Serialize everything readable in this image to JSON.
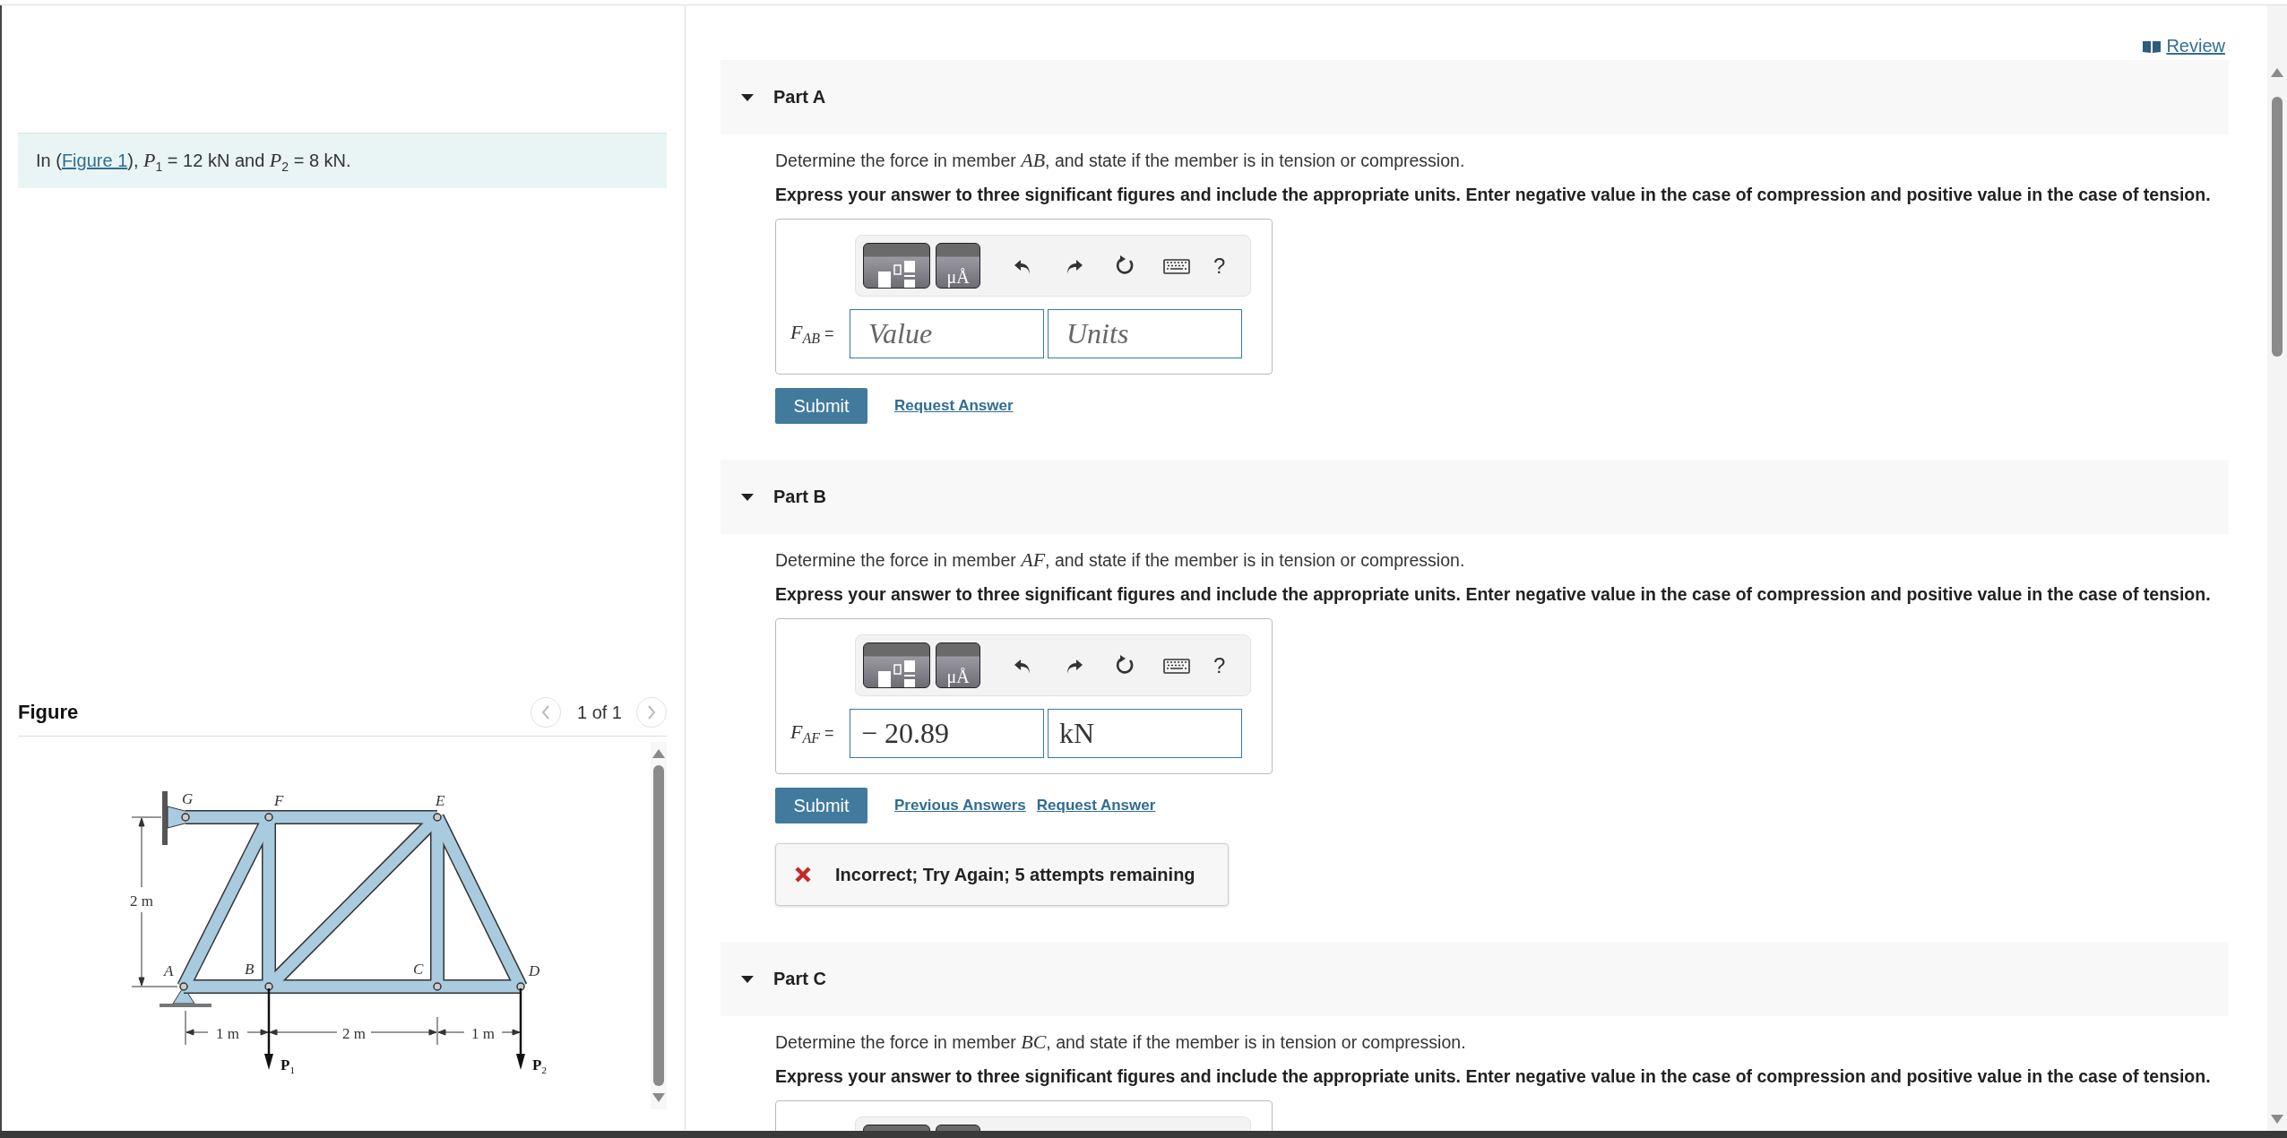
{
  "review_link": "Review",
  "problem": {
    "prefix": "In (",
    "link": "Figure 1",
    "suffix": "), *P*$_{1}$ = 12 kN and *P*$_{2}$ = 8 kN."
  },
  "figure": {
    "heading": "Figure",
    "pager": "1 of 1",
    "node_labels": [
      "G",
      "F",
      "E",
      "A",
      "B",
      "C",
      "D"
    ],
    "dimension_labels": [
      "2 m",
      "1 m",
      "2 m",
      "1 m"
    ],
    "load_labels": [
      "**P**$_{1}$",
      "**P**$_{2}$"
    ]
  },
  "parts": [
    {
      "title": "Part A",
      "expanded": true,
      "question": "Determine the force in member *AB*, and state if the member is in tension or compression.",
      "instruction": "Express your answer to three significant figures and include the appropriate units. Enter negative value in the case of compression and positive value in the case of tension.",
      "toolbar": {
        "units_button": "μÅ",
        "help": "?"
      },
      "answer": {
        "label": "*F*$_{AB}$ =",
        "value": {
          "placeholder": "Value"
        },
        "units": {
          "placeholder": "Units"
        }
      },
      "submit": "Submit",
      "links": [
        "Request Answer"
      ]
    },
    {
      "title": "Part B",
      "expanded": true,
      "question": "Determine the force in member *AF*, and state if the member is in tension or compression.",
      "instruction": "Express your answer to three significant figures and include the appropriate units. Enter negative value in the case of compression and positive value in the case of tension.",
      "toolbar": {
        "units_button": "μÅ",
        "help": "?"
      },
      "answer": {
        "label": "*F*$_{AF}$ =",
        "value": {
          "value": "− 20.89"
        },
        "units": {
          "value": "kN"
        }
      },
      "submit": "Submit",
      "links": [
        "Previous Answers",
        "Request Answer"
      ],
      "feedback": {
        "kind": "incorrect",
        "text": "Incorrect; Try Again; 5 attempts remaining"
      }
    },
    {
      "title": "Part C",
      "expanded": true,
      "question": "Determine the force in member *BC*, and state if the member is in tension or compression.",
      "instruction": "Express your answer to three significant figures and include the appropriate units. Enter negative value in the case of compression and positive value in the case of tension."
    }
  ]
}
